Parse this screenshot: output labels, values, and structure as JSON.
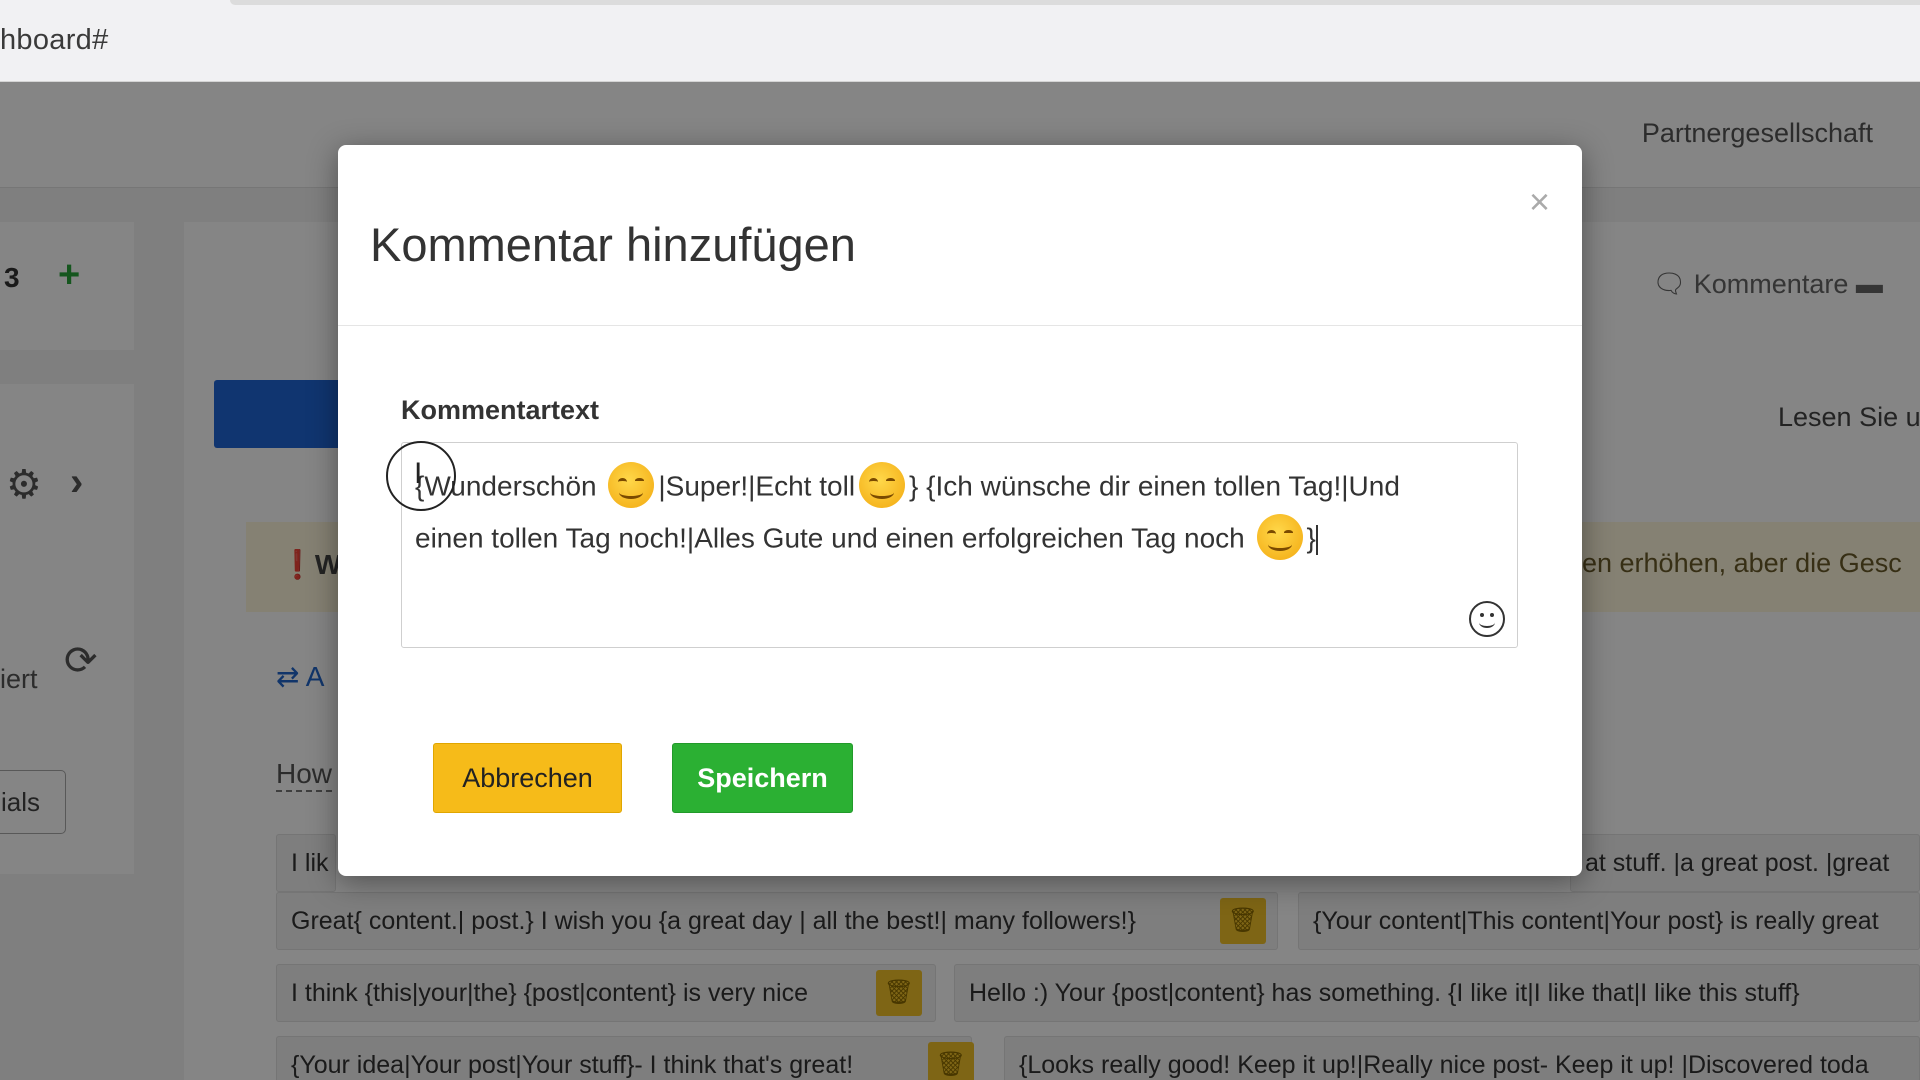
{
  "browser": {
    "url_fragment": "hboard#"
  },
  "background": {
    "navbar_right": "Partnergesellschaft",
    "left_count": "3",
    "left_plus": "+",
    "left_status_partial": "iert",
    "left_button_partial": "ials",
    "comments_header": "Kommentare",
    "read_more_partial": "Lesen Sie u",
    "warning_partial_left": "W",
    "warning_partial_right": "en erhöhen, aber die Gesc",
    "swap_label_partial": "A",
    "how_partial": "How",
    "chips": [
      "I lik",
      "at stuff. |a great post. |great",
      "Great{ content.| post.} I wish you {a great day | all the best!| many followers!}",
      "{Your content|This content|Your post} is really great",
      "I think {this|your|the} {post|content} is very nice",
      "Hello :) Your {post|content} has something. {I like it|I like that|I like this stuff}",
      "{Your idea|Your post|Your stuff}- I think that's great!",
      "{Looks really good! Keep it up!|Really nice post- Keep it up! |Discovered toda"
    ]
  },
  "modal": {
    "title": "Kommentar hinzufügen",
    "close_symbol": "×",
    "field_label": "Kommentartext",
    "text_line1_a": "{Wunderschön",
    "text_line1_b": "|Super!|Echt toll",
    "text_line1_c": "} {Ich wünsche dir einen tollen Tag!|Und",
    "text_line2_a": "einen tollen Tag noch!|Alles Gute und einen erfolgreichen Tag noch",
    "text_line2_b": "}",
    "cancel_label": "Abbrechen",
    "save_label": "Speichern"
  },
  "colors": {
    "cancel_button": "#f6bb19",
    "save_button": "#2bb033",
    "primary_blue": "#1f66d6",
    "warning_bg": "#fff8dd"
  },
  "icons": [
    "gear-icon",
    "chevron-right-icon",
    "refresh-icon",
    "swap-icon",
    "trash-icon",
    "comments-icon",
    "emoji-picker-icon",
    "close-icon",
    "smiley-emoji"
  ]
}
